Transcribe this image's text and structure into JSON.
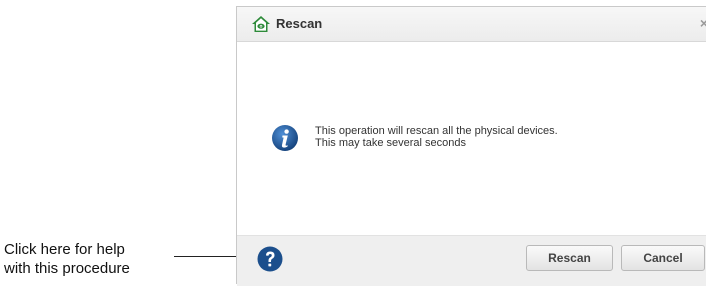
{
  "annotation": {
    "line1": "Click here for help",
    "line2": "with this procedure"
  },
  "dialog": {
    "title": "Rescan",
    "close_glyph": "×",
    "message": {
      "line1": "This operation will rescan all the physical devices.",
      "line2": "This may take several seconds"
    },
    "buttons": {
      "rescan": "Rescan",
      "cancel": "Cancel"
    },
    "icons": {
      "title": "home-eye-icon",
      "info": "info-icon",
      "help": "help-icon"
    },
    "colors": {
      "info_blue": "#1e5a9e",
      "help_blue": "#1c4f8c",
      "title_green": "#2e8b3a"
    }
  }
}
